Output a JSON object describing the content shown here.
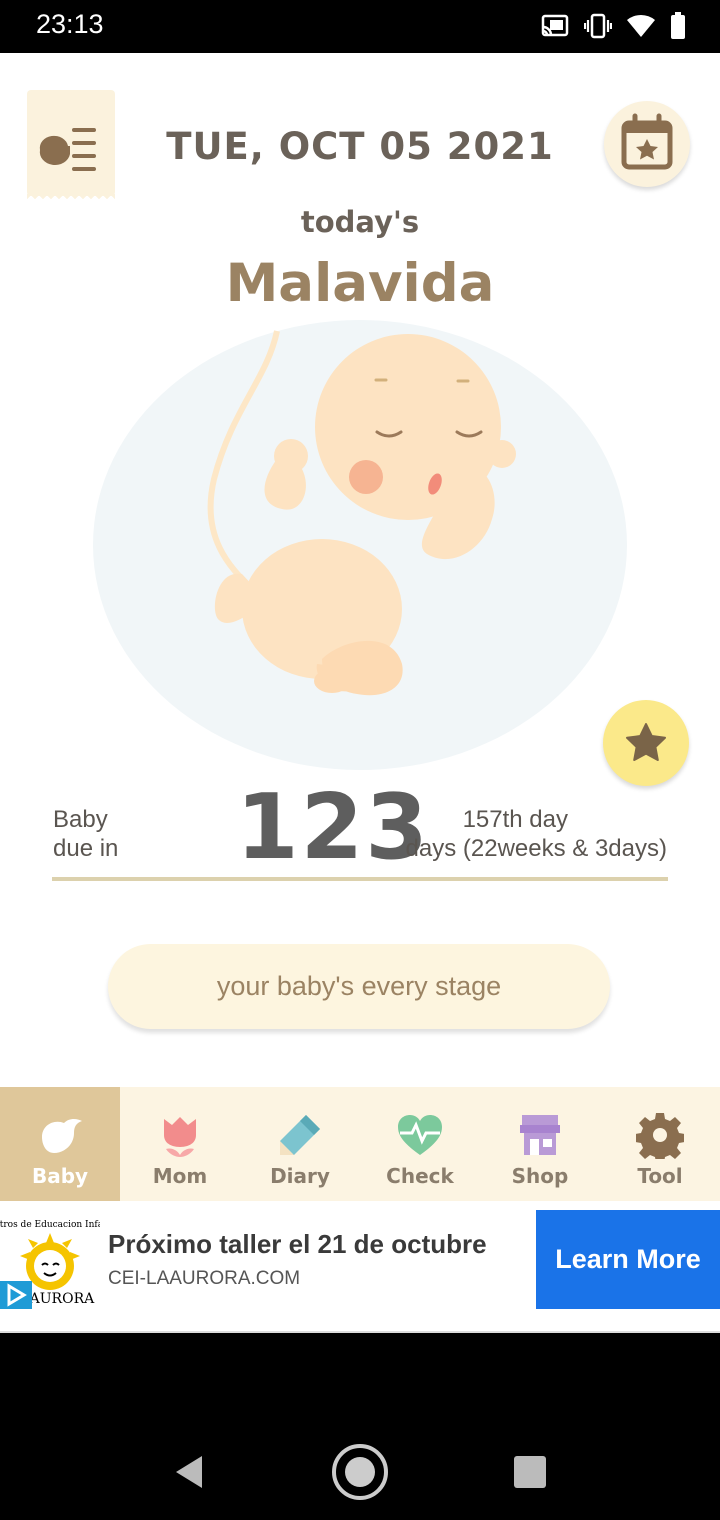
{
  "status_bar": {
    "time": "23:13"
  },
  "header": {
    "date": "TUE, OCT 05 2021",
    "todays_label": "today's",
    "name": "Malavida"
  },
  "due": {
    "label": "Baby\ndue in",
    "days": "123",
    "day_number": "157th day",
    "days_detail": "days (22weeks & 3days)",
    "progress_fraction": 0.56
  },
  "stage_button": "your baby's every stage",
  "tabs": [
    {
      "label": "Baby",
      "icon": "bird-icon",
      "active": true
    },
    {
      "label": "Mom",
      "icon": "tulip-icon",
      "active": false
    },
    {
      "label": "Diary",
      "icon": "pencil-icon",
      "active": false
    },
    {
      "label": "Check",
      "icon": "heartbeat-icon",
      "active": false
    },
    {
      "label": "Shop",
      "icon": "store-icon",
      "active": false
    },
    {
      "label": "Tool",
      "icon": "gear-icon",
      "active": false
    }
  ],
  "ad": {
    "logo_text": "Centros de Educacion Infantil LA AURORA",
    "title": "Próximo taller el 21 de octubre",
    "url": "CEI-LAAURORA.COM",
    "cta": "Learn More"
  },
  "colors": {
    "accent_tan": "#9b8363",
    "tab_bg": "#fcf4e2",
    "tab_active": "#dfc79a",
    "cta_blue": "#1a73e8",
    "star_yellow": "#fbe98a"
  }
}
